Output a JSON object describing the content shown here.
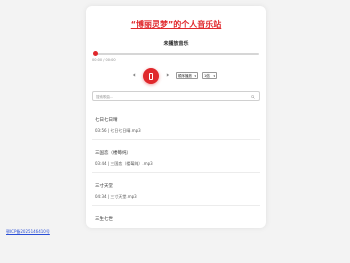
{
  "site": {
    "title": "“博丽灵梦”的个人音乐站"
  },
  "player": {
    "now_playing": "未播放音乐",
    "progress": 0,
    "time": "00:00 / 00:00",
    "prev_icon": "prev-icon",
    "play_icon": "play-icon",
    "next_icon": "next-icon",
    "mode_select": "顺序播放",
    "speed_select": "1倍",
    "accent_color": "#e0282c"
  },
  "search": {
    "placeholder": "搜索歌曲..."
  },
  "songs": [
    {
      "title": "七日七日晴",
      "meta": "03:56 | 七日七日晴.mp3"
    },
    {
      "title": "三国恋（楼莓纯）",
      "meta": "03:44 | 三国恋（楼莓纯）.mp3"
    },
    {
      "title": "三寸天堂",
      "meta": "04:34 | 三寸天堂.mp3"
    },
    {
      "title": "三生七世",
      "meta": ""
    }
  ],
  "footer": {
    "icp": "鄂ICP备2025146410号"
  }
}
